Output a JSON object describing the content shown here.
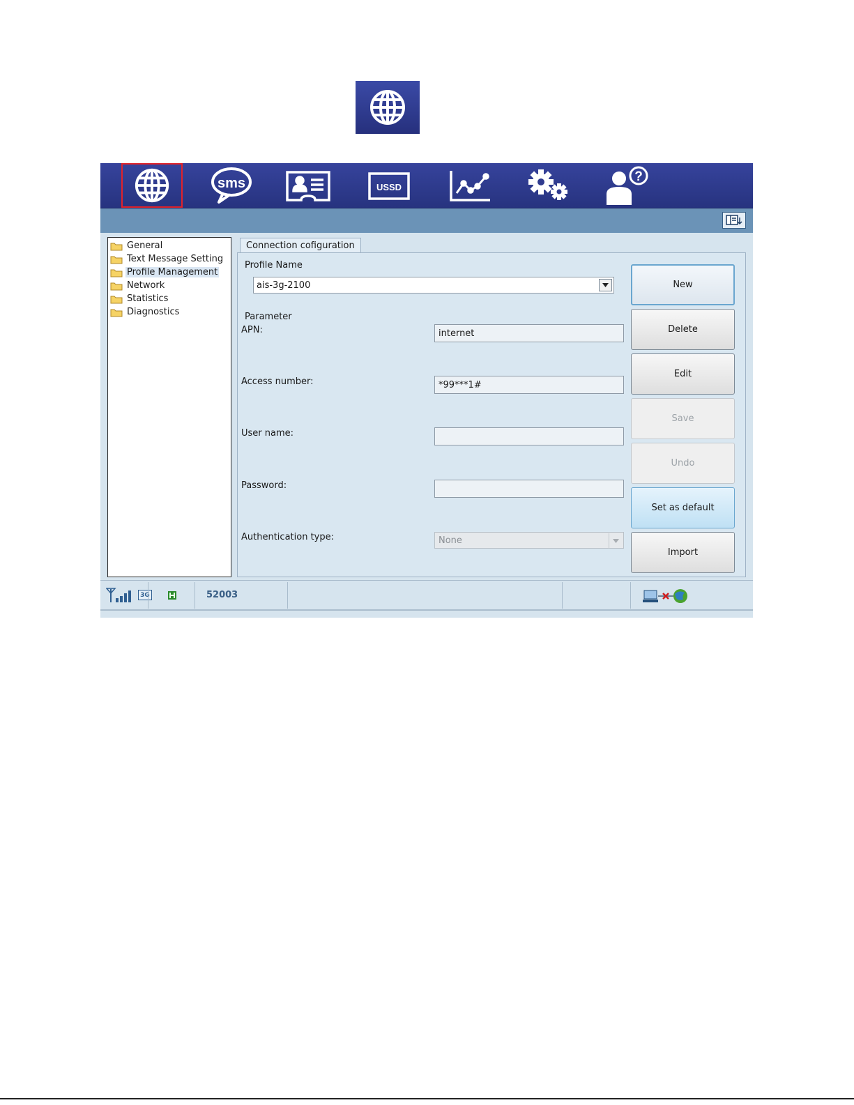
{
  "toolbar": {
    "items": [
      {
        "icon": "globe-icon",
        "selected": true
      },
      {
        "icon": "sms-icon",
        "label": "sms"
      },
      {
        "icon": "contacts-icon"
      },
      {
        "icon": "ussd-icon",
        "label": "USSD"
      },
      {
        "icon": "statistics-icon"
      },
      {
        "icon": "settings-icon"
      },
      {
        "icon": "help-icon"
      }
    ],
    "selected_color": "#e1222a"
  },
  "sidebar": {
    "items": [
      {
        "label": "General"
      },
      {
        "label": "Text Message Setting"
      },
      {
        "label": "Profile Management",
        "active": true
      },
      {
        "label": "Network"
      },
      {
        "label": "Statistics"
      },
      {
        "label": "Diagnostics"
      }
    ]
  },
  "tab": {
    "label": "Connection cofiguration"
  },
  "profile": {
    "group_label": "Profile Name",
    "selected": "ais-3g-2100"
  },
  "parameter": {
    "group_label": "Parameter",
    "apn": {
      "label": "APN:",
      "value": "internet"
    },
    "access_number": {
      "label": "Access number:",
      "value": "*99***1#"
    },
    "user_name": {
      "label": "User name:",
      "value": ""
    },
    "password": {
      "label": "Password:",
      "value": ""
    },
    "auth_type": {
      "label": "Authentication type:",
      "value": "None"
    }
  },
  "buttons": {
    "new": "New",
    "delete": "Delete",
    "edit": "Edit",
    "save": "Save",
    "undo": "Undo",
    "set_default": "Set as default",
    "import": "Import"
  },
  "status": {
    "network_type": "3G",
    "operator": "52003"
  },
  "colors": {
    "toolbar": "#2f3b8f",
    "subbar": "#6b93b7",
    "panel": "#d9e7f1"
  }
}
